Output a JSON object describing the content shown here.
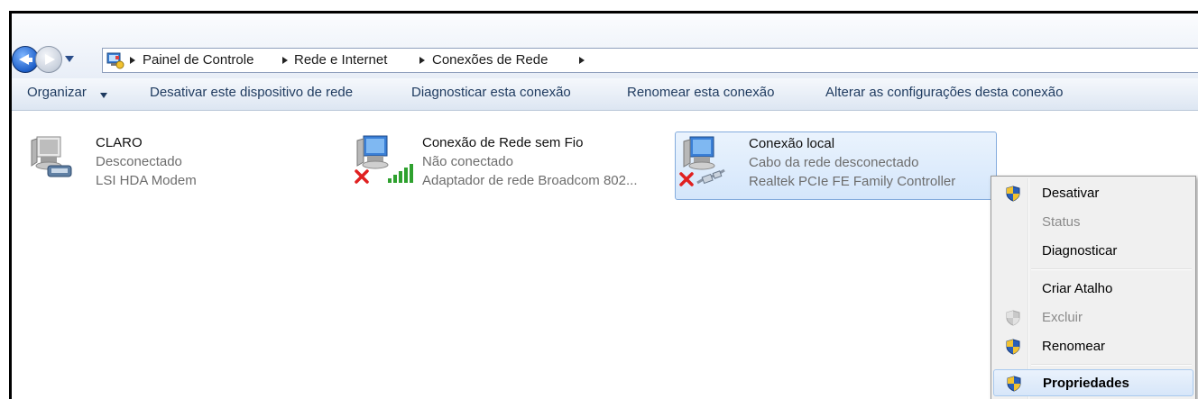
{
  "breadcrumb": {
    "items": [
      "Painel de Controle",
      "Rede e Internet",
      "Conexões de Rede"
    ]
  },
  "toolbar": {
    "organize": "Organizar",
    "disable": "Desativar este dispositivo de rede",
    "diagnose": "Diagnosticar esta conexão",
    "rename": "Renomear esta conexão",
    "change": "Alterar as configurações desta conexão"
  },
  "connections": [
    {
      "name": "CLARO",
      "status": "Desconectado",
      "device": "LSI HDA Modem",
      "icon": "dialup-modem-icon"
    },
    {
      "name": "Conexão de Rede sem Fio",
      "status": "Não conectado",
      "device": "Adaptador de rede Broadcom 802...",
      "icon": "wireless-network-icon"
    },
    {
      "name": "Conexão local",
      "status": "Cabo da rede desconectado",
      "device": "Realtek PCIe FE Family Controller",
      "icon": "ethernet-network-icon"
    }
  ],
  "context_menu": {
    "items": [
      {
        "label": "Desativar",
        "enabled": true,
        "shield": true
      },
      {
        "label": "Status",
        "enabled": false,
        "shield": false
      },
      {
        "label": "Diagnosticar",
        "enabled": true,
        "shield": false
      },
      {
        "label": "Criar Atalho",
        "enabled": true,
        "shield": false
      },
      {
        "label": "Excluir",
        "enabled": false,
        "shield": true
      },
      {
        "label": "Renomear",
        "enabled": true,
        "shield": true
      },
      {
        "label": "Propriedades",
        "enabled": true,
        "shield": true,
        "default": true
      }
    ]
  },
  "colors": {
    "accent": "#1d5fc9",
    "selection": "#d4e6fb",
    "error": "#e02020",
    "signal": "#2fa12f"
  }
}
